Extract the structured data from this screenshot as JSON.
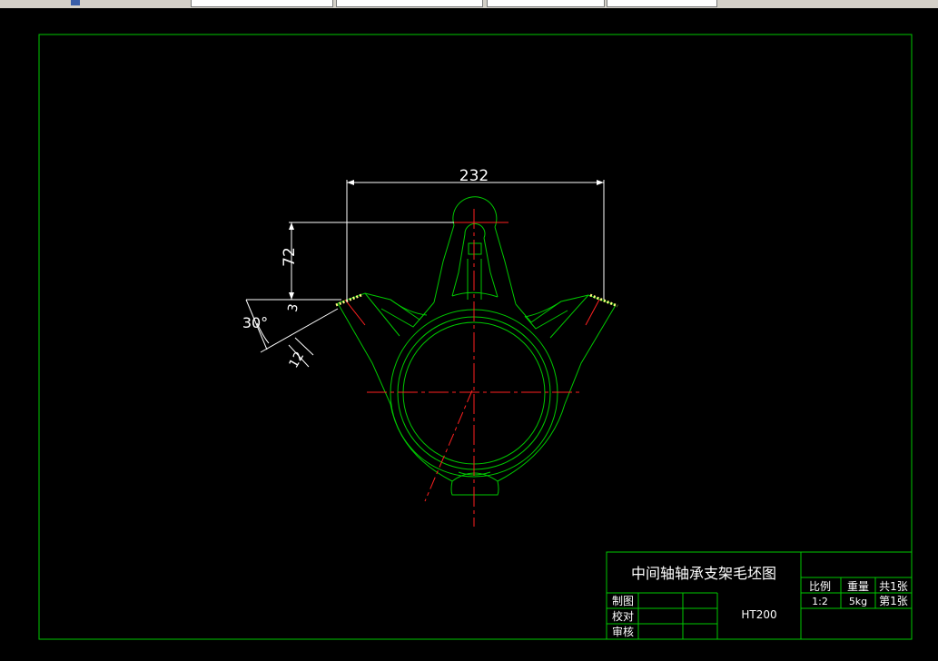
{
  "toolbar": {
    "fields": [
      "",
      "",
      "",
      "",
      ""
    ]
  },
  "drawing": {
    "dimensions": {
      "width": "232",
      "height": "72",
      "angle": "30°",
      "small_a": "3",
      "small_b": "12"
    }
  },
  "title_block": {
    "title": "中间轴轴承支架毛坯图",
    "scale_label": "比例",
    "weight_label": "重量",
    "sheets_total": "共1张",
    "scale_value": "1:2",
    "weight_value": "5kg",
    "sheet_number": "第1张",
    "material": "HT200",
    "drawn_by_label": "制图",
    "checked_label": "校对",
    "approved_label": "审核"
  },
  "colors": {
    "outline": "#00c800",
    "centerline": "#ff2020",
    "dimension": "#ffffff",
    "hatch": "#ffff80"
  }
}
